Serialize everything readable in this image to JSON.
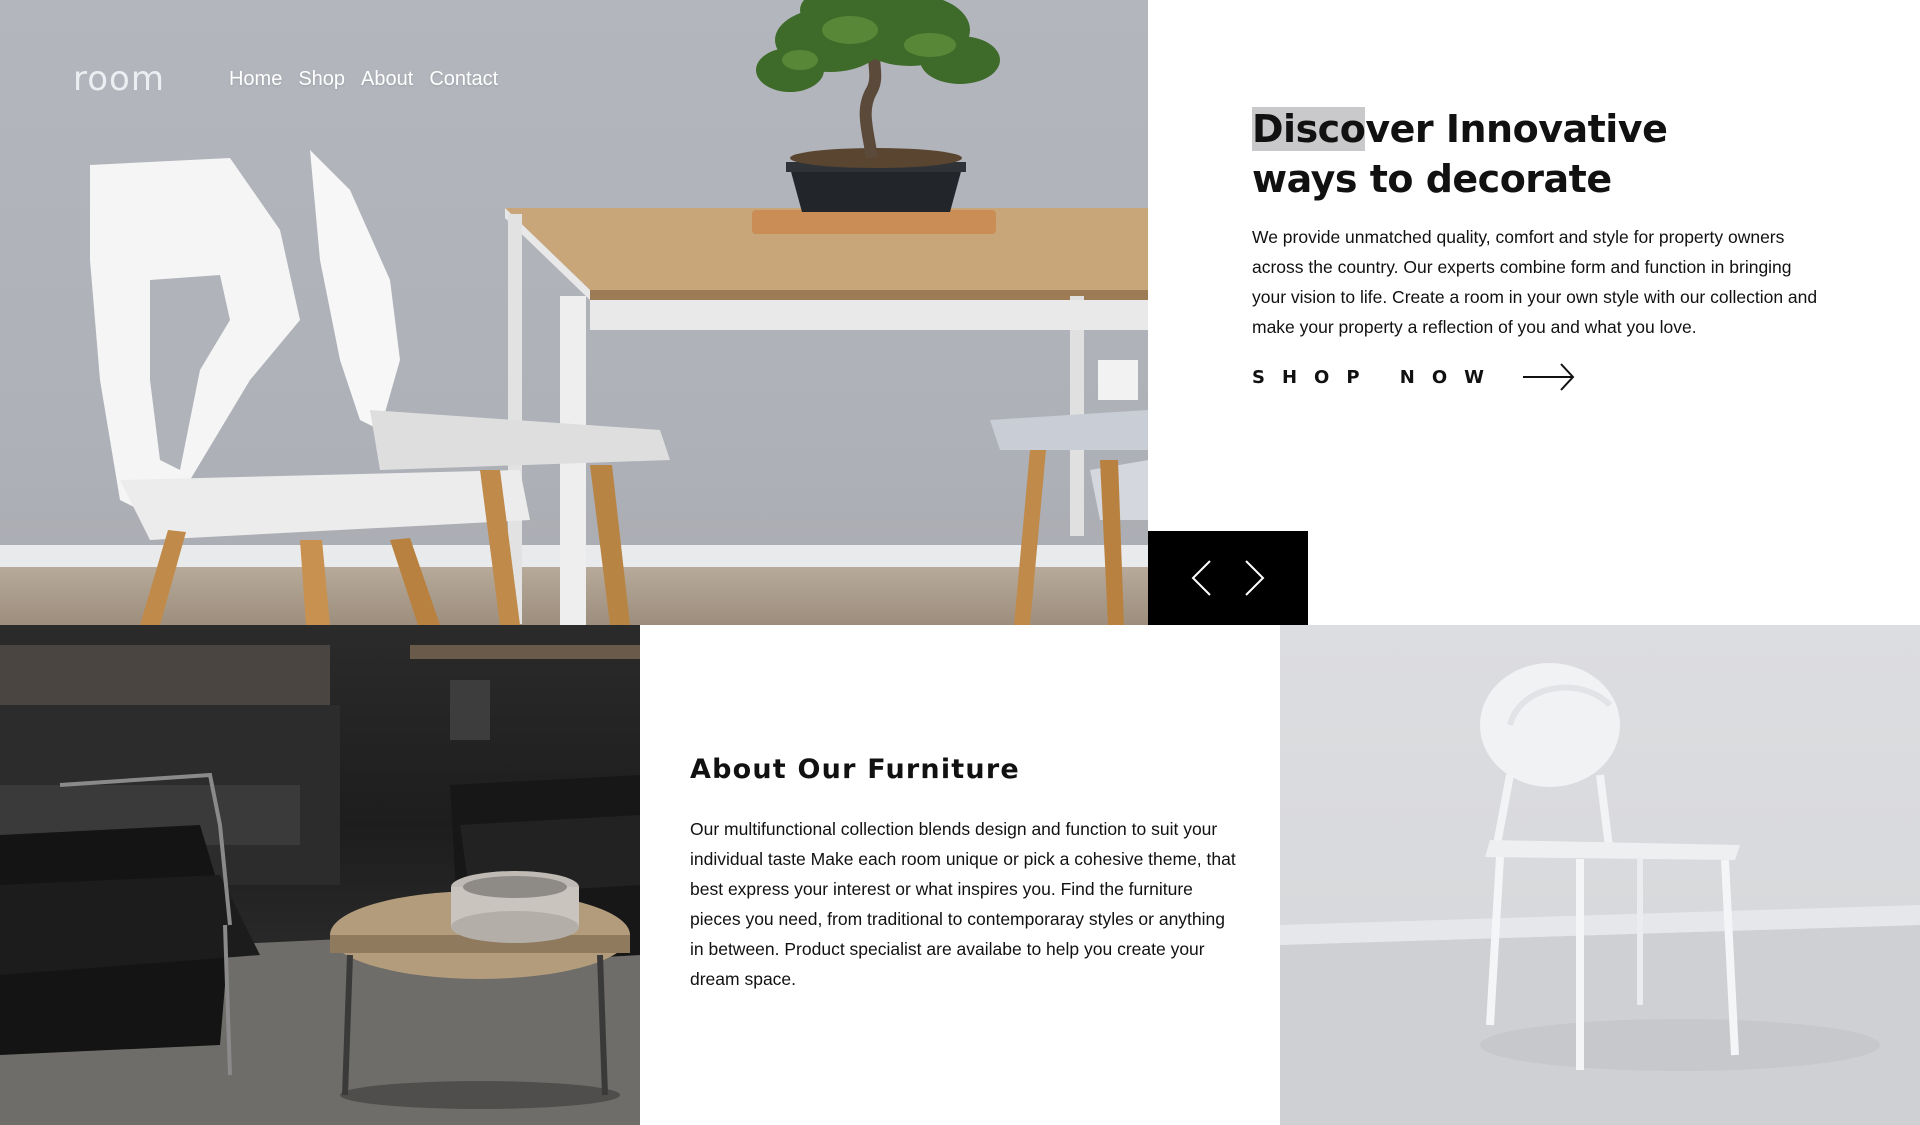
{
  "brand": {
    "logo_text": "room"
  },
  "nav": {
    "items": [
      {
        "label": "Home"
      },
      {
        "label": "Shop"
      },
      {
        "label": "About"
      },
      {
        "label": "Contact"
      }
    ]
  },
  "hero": {
    "title_highlight": "Disco",
    "title_rest_line1": "ver Innovative",
    "title_line2": "ways to decorate",
    "description": "We provide unmatched quality, comfort and style for property owners across the country. Our experts combine form and function in bringing your vision to life. Create a room in your own style with our collection and make your property a reflection of you and what you love.",
    "cta_label": "SHOP NOW",
    "cta_icon": "arrow-right-icon",
    "image_subject": "white chairs at wooden table with bonsai"
  },
  "slider": {
    "prev_icon": "chevron-left-icon",
    "next_icon": "chevron-right-icon",
    "background": "#000000"
  },
  "about": {
    "title": "About Our Furniture",
    "description": "Our multifunctional collection blends design and function to suit your individual taste Make each room unique or pick a cohesive theme, that best express your interest or what inspires you. Find the furniture pieces you need, from traditional to contemporaray styles or anything in between. Product specialist are availabe to help you create your dream space.",
    "left_image_subject": "dark living room with armchair and round coffee table",
    "right_image_subject": "white chair against light grey wall"
  },
  "colors": {
    "text": "#111111",
    "highlight": "#c9c9cb",
    "background": "#ffffff"
  }
}
